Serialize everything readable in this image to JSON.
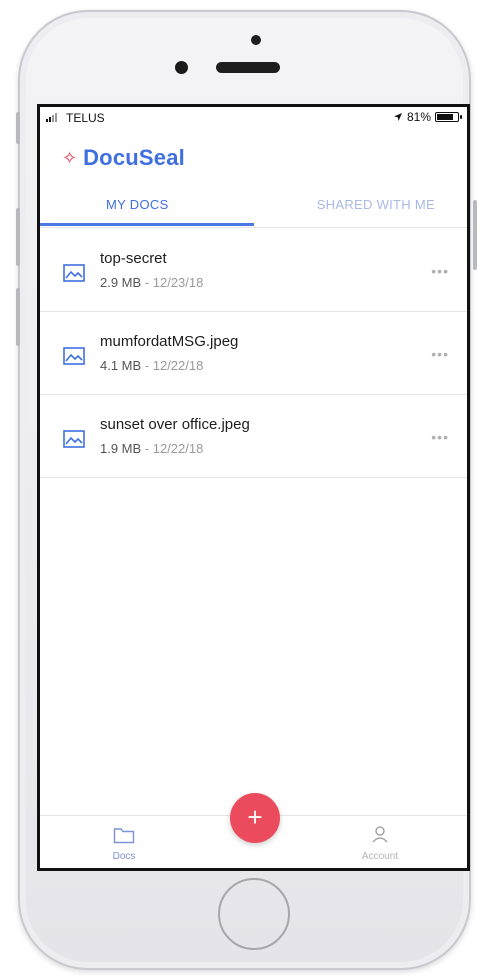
{
  "status_bar": {
    "carrier": "TELUS",
    "battery_text": "81%",
    "battery_level": 0.81
  },
  "app": {
    "brand_name": "DocuSeal",
    "brand_color": "#3f6fe0",
    "accent_color": "#ec4b5e"
  },
  "tabs": [
    {
      "label": "MY DOCS",
      "active": true
    },
    {
      "label": "SHARED WITH ME",
      "active": false
    }
  ],
  "documents": [
    {
      "name": "top-secret",
      "size": "2.9 MB",
      "date": " - 12/23/18",
      "icon": "image-file-icon"
    },
    {
      "name": "mumfordatMSG.jpeg",
      "size": "4.1 MB",
      "date": " - 12/22/18",
      "icon": "image-file-icon"
    },
    {
      "name": "sunset over office.jpeg",
      "size": "1.9 MB",
      "date": " - 12/22/18",
      "icon": "image-file-icon"
    }
  ],
  "more_label": "•••",
  "fab_label": "+",
  "bottom_nav": {
    "docs_label": "Docs",
    "account_label": "Account"
  }
}
